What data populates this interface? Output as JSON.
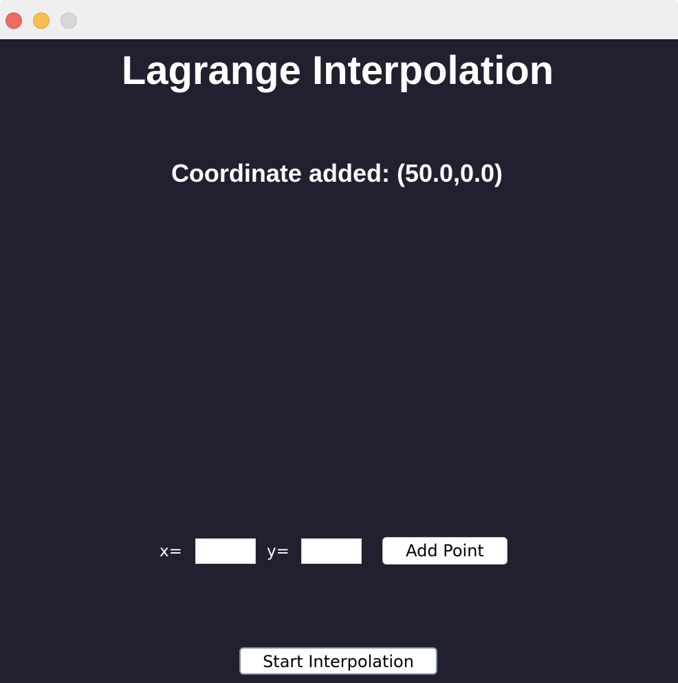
{
  "window": {
    "controls": {
      "close": "close-button",
      "minimize": "minimize-button",
      "zoom": "zoom-button"
    },
    "colors": {
      "background": "#21202e",
      "titlebar": "#efeff1",
      "close": "#ee6a5e",
      "minimize": "#f5be4f",
      "zoom": "#d7d7d9"
    }
  },
  "app": {
    "title": "Lagrange Interpolation",
    "status": "Coordinate added: (50.0,0.0)"
  },
  "form": {
    "x_label": "x=",
    "x_value": "",
    "y_label": "y=",
    "y_value": "",
    "add_button": "Add Point"
  },
  "actions": {
    "start_button": "Start Interpolation"
  }
}
